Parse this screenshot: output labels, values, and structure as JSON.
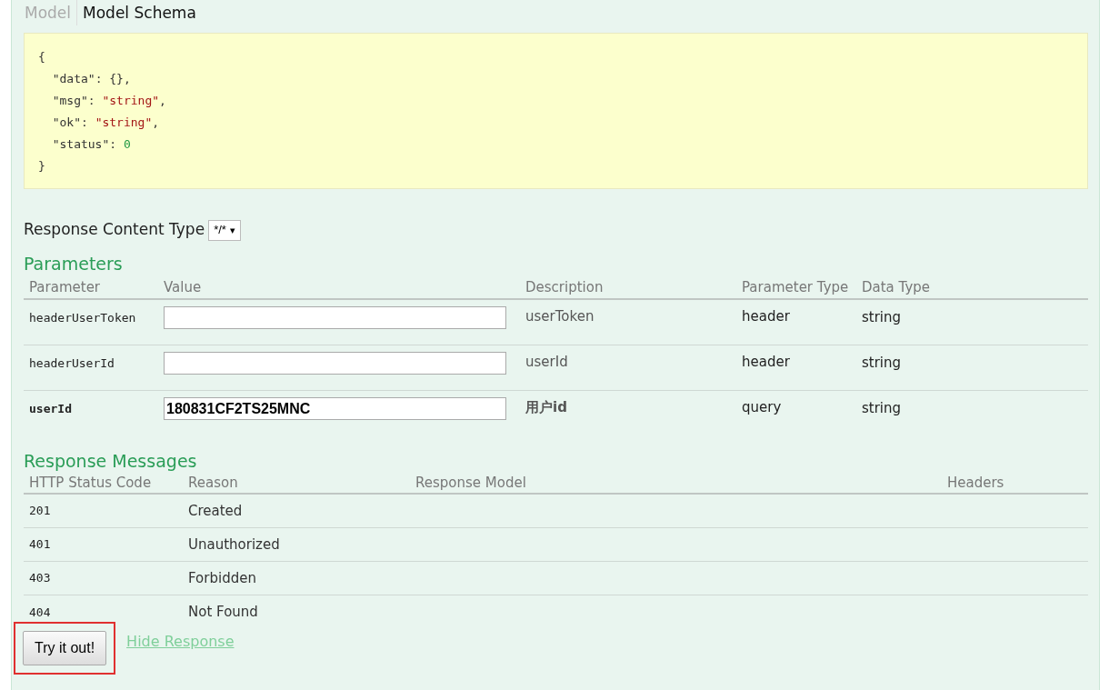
{
  "model_tabs": [
    {
      "label": "Model",
      "selected": false
    },
    {
      "label": "Model Schema",
      "selected": true
    }
  ],
  "schema_lines": [
    [
      {
        "text": "{",
        "kind": "punct"
      }
    ],
    [
      {
        "text": "  \"data\"",
        "kind": "key"
      },
      {
        "text": ": {},",
        "kind": "punct"
      }
    ],
    [
      {
        "text": "  \"msg\"",
        "kind": "key"
      },
      {
        "text": ": ",
        "kind": "punct"
      },
      {
        "text": "\"string\"",
        "kind": "string"
      },
      {
        "text": ",",
        "kind": "punct"
      }
    ],
    [
      {
        "text": "  \"ok\"",
        "kind": "key"
      },
      {
        "text": ": ",
        "kind": "punct"
      },
      {
        "text": "\"string\"",
        "kind": "string"
      },
      {
        "text": ",",
        "kind": "punct"
      }
    ],
    [
      {
        "text": "  \"status\"",
        "kind": "key"
      },
      {
        "text": ": ",
        "kind": "punct"
      },
      {
        "text": "0",
        "kind": "number"
      }
    ],
    [
      {
        "text": "}",
        "kind": "punct"
      }
    ]
  ],
  "content_type": {
    "label": "Response Content Type",
    "value": "*/*",
    "arrow": "▾"
  },
  "parameters": {
    "title": "Parameters",
    "columns": [
      "Parameter",
      "Value",
      "Description",
      "Parameter Type",
      "Data Type"
    ],
    "rows": [
      {
        "name": "headerUserToken",
        "value": "",
        "description": "userToken",
        "param_type": "header",
        "data_type": "string",
        "required": false
      },
      {
        "name": "headerUserId",
        "value": "",
        "description": "userId",
        "param_type": "header",
        "data_type": "string",
        "required": false
      },
      {
        "name": "userId",
        "value": "180831CF2TS25MNC",
        "description": "用户id",
        "param_type": "query",
        "data_type": "string",
        "required": true
      }
    ]
  },
  "responses": {
    "title": "Response Messages",
    "columns": [
      "HTTP Status Code",
      "Reason",
      "Response Model",
      "Headers"
    ],
    "rows": [
      {
        "code": "201",
        "reason": "Created"
      },
      {
        "code": "401",
        "reason": "Unauthorized"
      },
      {
        "code": "403",
        "reason": "Forbidden"
      },
      {
        "code": "404",
        "reason": "Not Found"
      }
    ]
  },
  "try_button": {
    "label": "Try it out!",
    "highlighted": true
  },
  "hide_link": "Hide Response"
}
